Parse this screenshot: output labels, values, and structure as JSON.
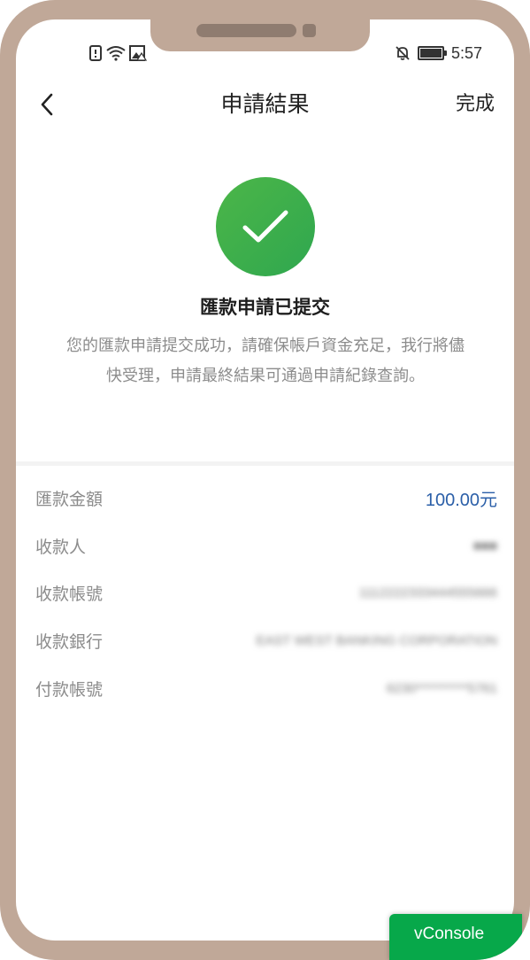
{
  "status_bar": {
    "time": "5:57",
    "icons_left": [
      "sim-alert-icon",
      "wifi-icon",
      "image-warning-icon"
    ],
    "icons_right": [
      "mute-bell-icon",
      "battery-icon"
    ]
  },
  "header": {
    "title": "申請結果",
    "done_label": "完成",
    "back_icon": "chevron-left-icon"
  },
  "result": {
    "icon": "check-icon",
    "icon_color": "#3fae4d",
    "title": "匯款申請已提交",
    "description": "您的匯款申請提交成功，請確保帳戶資金充足，我行將儘快受理，申請最終結果可通過申請紀錄查詢。"
  },
  "details": [
    {
      "label": "匯款金額",
      "value": "100.00元",
      "blurred": false,
      "value_color": "#2b5fa8"
    },
    {
      "label": "收款人",
      "value": "■■■",
      "blurred": true
    },
    {
      "label": "收款帳號",
      "value": "1112222333444555666",
      "blurred": true
    },
    {
      "label": "收款銀行",
      "value": "EAST WEST BANKING CORPORATION",
      "blurred": true
    },
    {
      "label": "付款帳號",
      "value": "6230**********5761",
      "blurred": true
    }
  ],
  "vconsole": {
    "label": "vConsole"
  },
  "colors": {
    "frame": "#c0a898",
    "accent_green": "#07a84a"
  }
}
